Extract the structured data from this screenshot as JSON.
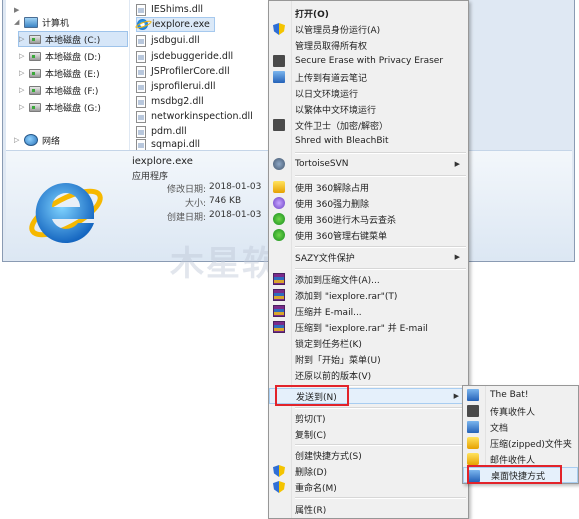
{
  "nav": {
    "computer_label": "计算机",
    "drives": [
      "本地磁盘 (C:)",
      "本地磁盘 (D:)",
      "本地磁盘 (E:)",
      "本地磁盘 (F:)",
      "本地磁盘 (G:)"
    ],
    "network_label": "网络"
  },
  "files": [
    "IEShims.dll",
    "iexplore.exe",
    "jsdbgui.dll",
    "jsdebuggeride.dll",
    "JSProfilerCore.dll",
    "jsprofilerui.dll",
    "msdbg2.dll",
    "networkinspection.dll",
    "pdm.dll",
    "sqmapi.dll"
  ],
  "details": {
    "name": "iexplore.exe",
    "type": "应用程序",
    "modified_label": "修改日期:",
    "modified_value": "2018-01-03",
    "size_label": "大小:",
    "size_value": "746 KB",
    "created_label": "创建日期:",
    "created_value": "2018-01-03"
  },
  "context_menu": {
    "open": "打开(O)",
    "run_as_admin": "以管理员身份运行(A)",
    "take_ownership": "管理员取得所有权",
    "secure_erase": "Secure Erase with Privacy Eraser",
    "upload_youdao": "上传到有道云笔记",
    "run_japanese": "以日文环境运行",
    "run_traditional": "以繁体中文环境运行",
    "file_guard": "文件卫士（加密/解密）",
    "shred_bleachbit": "Shred with BleachBit",
    "tortoise_svn": "TortoiseSVN",
    "unlock_360": "使用 360解除占用",
    "force_delete_360": "使用 360强力删除",
    "scan_360": "使用 360进行木马云查杀",
    "menu_360": "使用 360管理右键菜单",
    "sazy": "SAZY文件保护",
    "add_archive": "添加到压缩文件(A)...",
    "add_rar": "添加到 \"iexplore.rar\"(T)",
    "compress_email": "压缩并 E-mail...",
    "compress_rar_email": "压缩到 \"iexplore.rar\" 并 E-mail",
    "pin_taskbar": "锁定到任务栏(K)",
    "pin_start": "附到「开始」菜单(U)",
    "restore_previous": "还原以前的版本(V)",
    "send_to": "发送到(N)",
    "cut": "剪切(T)",
    "copy": "复制(C)",
    "create_shortcut": "创建快捷方式(S)",
    "delete": "删除(D)",
    "rename": "重命名(M)",
    "properties": "属性(R)"
  },
  "send_to_menu": {
    "items": [
      "The Bat!",
      "传真收件人",
      "文档",
      "压缩(zipped)文件夹",
      "邮件收件人",
      "桌面快捷方式"
    ]
  },
  "colors": {
    "highlight_border": "#e2232a",
    "menu_background": "#f0f0f0"
  }
}
